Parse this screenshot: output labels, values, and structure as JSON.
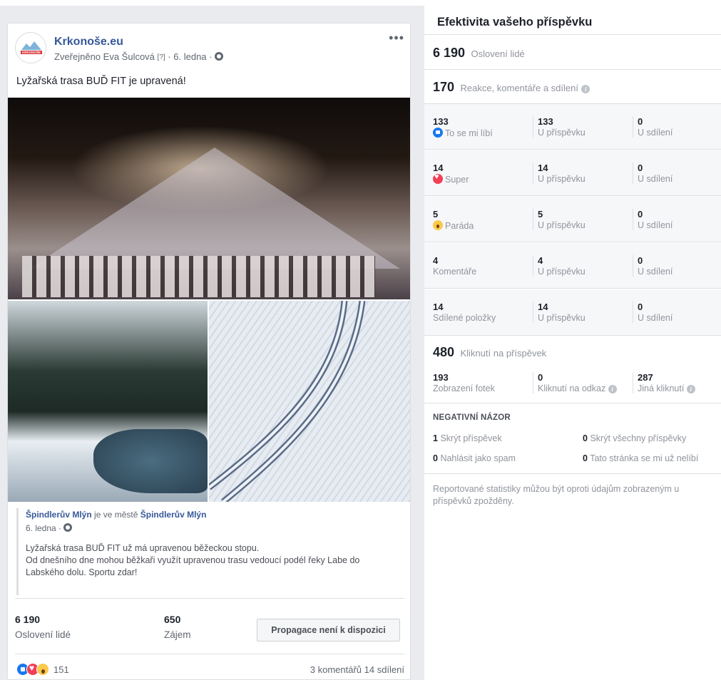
{
  "post": {
    "page_name": "Krkonoše.eu",
    "avatar_logo_text": "KRKONOŠE",
    "meta": {
      "published_by": "Zveřejněno Eva Šulcová",
      "help_mark": "[?]",
      "separator": "·",
      "date": "6. ledna"
    },
    "more_label": "•••",
    "text": "Lyžařská trasa BUĎ FIT je upravená!",
    "shared": {
      "author": "Špindlerův Mlýn",
      "in_city": "je ve městě",
      "city": "Špindlerův Mlýn",
      "date": "6. ledna ·",
      "text_line1": "Lyžařská trasa BUĎ FIT už má upravenou běžeckou stopu.",
      "text_line2": "Od dnešního dne mohou běžkaři využít upravenou trasu vedoucí podél řeky Labe do Labského dolu. Sportu zdar!"
    },
    "stats": {
      "reach_value": "6 190",
      "reach_label": "Oslovení lidé",
      "engagement_value": "650",
      "engagement_label": "Zájem",
      "promote_button": "Propagace není k dispozici"
    },
    "footer": {
      "reactions_count": "151",
      "comments_shares": "3 komentářů  14 sdílení"
    }
  },
  "insights": {
    "title": "Efektivita vašeho příspěvku",
    "reach": {
      "value": "6 190",
      "label": "Oslovení lidé"
    },
    "interactions": {
      "value": "170",
      "label": "Reakce, komentáře a sdílení"
    },
    "rows": [
      {
        "total": "133",
        "label": "To se mi líbí",
        "icon": "like-icon",
        "on_post": "133",
        "on_post_label": "U příspěvku",
        "on_shares": "0",
        "on_shares_label": "U sdílení"
      },
      {
        "total": "14",
        "label": "Super",
        "icon": "love-icon",
        "on_post": "14",
        "on_post_label": "U příspěvku",
        "on_shares": "0",
        "on_shares_label": "U sdílení"
      },
      {
        "total": "5",
        "label": "Paráda",
        "icon": "wow-icon",
        "on_post": "5",
        "on_post_label": "U příspěvku",
        "on_shares": "0",
        "on_shares_label": "U sdílení"
      },
      {
        "total": "4",
        "label": "Komentáře",
        "icon": "",
        "on_post": "4",
        "on_post_label": "U příspěvku",
        "on_shares": "0",
        "on_shares_label": "U sdílení"
      },
      {
        "total": "14",
        "label": "Sdílené položky",
        "icon": "",
        "on_post": "14",
        "on_post_label": "U příspěvku",
        "on_shares": "0",
        "on_shares_label": "U sdílení"
      }
    ],
    "clicks": {
      "value": "480",
      "label": "Kliknutí na příspěvek"
    },
    "click_breakdown": [
      {
        "value": "193",
        "label": "Zobrazení fotek"
      },
      {
        "value": "0",
        "label": "Kliknutí na odkaz"
      },
      {
        "value": "287",
        "label": "Jiná kliknutí"
      }
    ],
    "negative": {
      "title": "NEGATIVNÍ NÁZOR",
      "hide_post_value": "1",
      "hide_post_label": "Skrýt příspěvek",
      "hide_all_value": "0",
      "hide_all_label": "Skrýt všechny příspěvky",
      "spam_value": "0",
      "spam_label": "Nahlásit jako spam",
      "unlike_value": "0",
      "unlike_label": "Tato stránka se mi už nelíbí"
    },
    "disclaimer": "Reportované statistiky můžou být oproti údajům zobrazeným u příspěvků zpožděny.",
    "info_glyph": "i"
  },
  "colors": {
    "link_blue": "#365899",
    "like_blue": "#1877f2",
    "love_red": "#f33e58",
    "wow_yellow": "#fcc94a",
    "muted_text": "#90949c",
    "page_grey": "#e9ebee"
  }
}
